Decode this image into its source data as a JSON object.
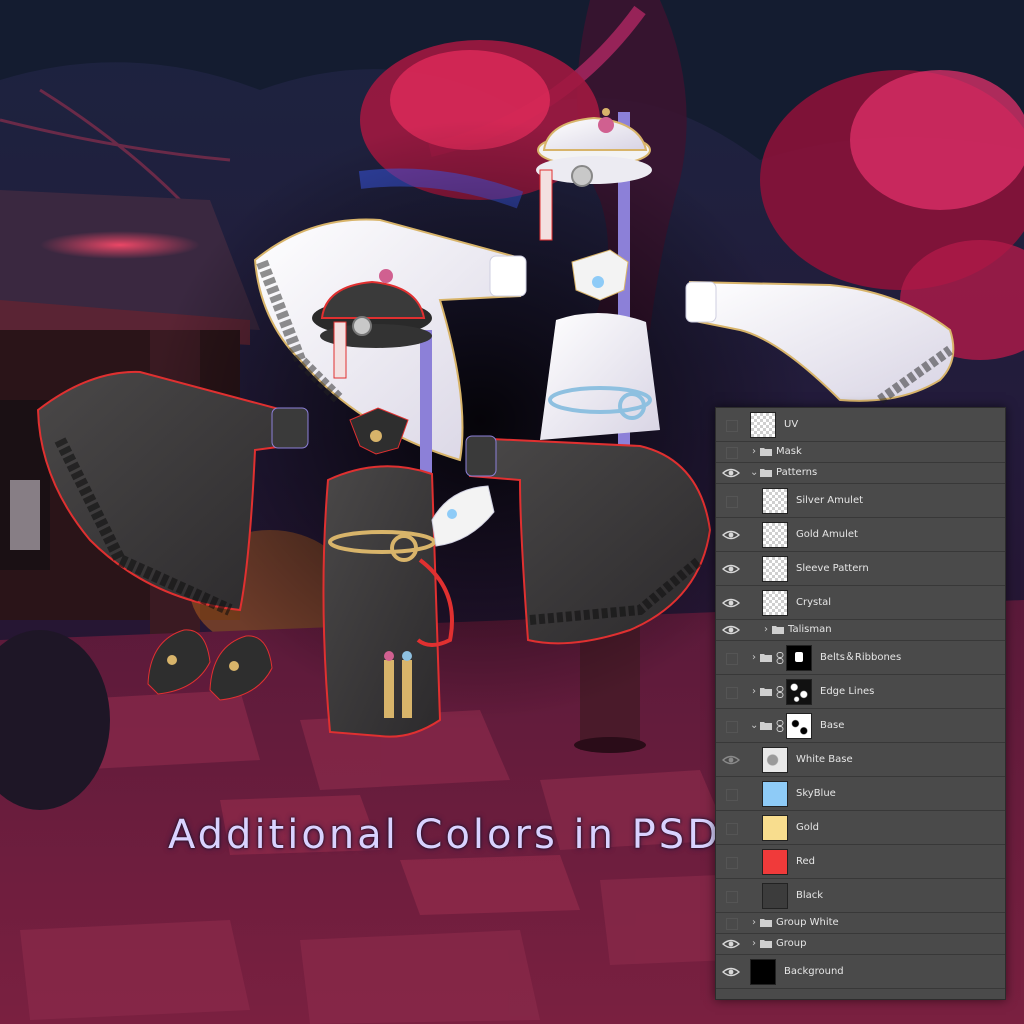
{
  "caption": "Additional Colors in PSD",
  "layers_panel": {
    "layers": [
      {
        "name": "UV",
        "kind": "layer",
        "thumb": "trans",
        "visible": false,
        "indent": 0,
        "expanded": null
      },
      {
        "name": "Mask",
        "kind": "group",
        "visible": false,
        "indent": 0,
        "expanded": false
      },
      {
        "name": "Patterns",
        "kind": "group",
        "visible": true,
        "indent": 0,
        "expanded": true
      },
      {
        "name": "Silver Amulet",
        "kind": "layer",
        "thumb": "trans",
        "visible": false,
        "indent": 1
      },
      {
        "name": "Gold Amulet",
        "kind": "layer",
        "thumb": "trans",
        "visible": true,
        "indent": 1
      },
      {
        "name": "Sleeve Pattern",
        "kind": "layer",
        "thumb": "trans",
        "visible": true,
        "indent": 1
      },
      {
        "name": "Crystal",
        "kind": "layer",
        "thumb": "trans",
        "visible": true,
        "indent": 1
      },
      {
        "name": "Talisman",
        "kind": "group",
        "visible": true,
        "indent": 1,
        "expanded": false
      },
      {
        "name": "Belts＆Ribbones",
        "kind": "group-mask",
        "thumb": "mask-black",
        "visible": false,
        "indent": 0,
        "expanded": false
      },
      {
        "name": "Edge Lines",
        "kind": "group-mask",
        "thumb": "mask-noise",
        "visible": false,
        "indent": 0,
        "expanded": false
      },
      {
        "name": "Base",
        "kind": "group-mask",
        "thumb": "mask-white",
        "visible": false,
        "indent": 0,
        "expanded": true
      },
      {
        "name": "White Base",
        "kind": "layer",
        "thumb": "mask-gray",
        "visible": "dim",
        "indent": 1
      },
      {
        "name": "SkyBlue",
        "kind": "layer",
        "swatch": "#8ecbf7",
        "visible": false,
        "indent": 1
      },
      {
        "name": "Gold",
        "kind": "layer",
        "swatch": "#f8dd8e",
        "visible": false,
        "indent": 1
      },
      {
        "name": "Red",
        "kind": "layer",
        "swatch": "#f03a3a",
        "visible": false,
        "indent": 1
      },
      {
        "name": "Black",
        "kind": "layer",
        "swatch": "#3c3c3c",
        "visible": false,
        "indent": 1
      },
      {
        "name": "Group White",
        "kind": "group",
        "visible": false,
        "indent": 0,
        "expanded": false
      },
      {
        "name": "Group",
        "kind": "group",
        "visible": true,
        "indent": 0,
        "expanded": false
      },
      {
        "name": "Background",
        "kind": "layer",
        "swatch": "#000000",
        "visible": true,
        "indent": 0
      }
    ]
  },
  "colors": {
    "panel_bg": "#4a4a4a",
    "caption": "#d9d2ff",
    "scene_sky": "#1c2440",
    "foliage_red": "#d8204a",
    "garment_black": "#3a3a3a",
    "garment_white": "#f3f3f3",
    "trim_red": "#e03030",
    "trim_gold": "#d8b46a",
    "ribbon_purple": "#8c80d8"
  }
}
